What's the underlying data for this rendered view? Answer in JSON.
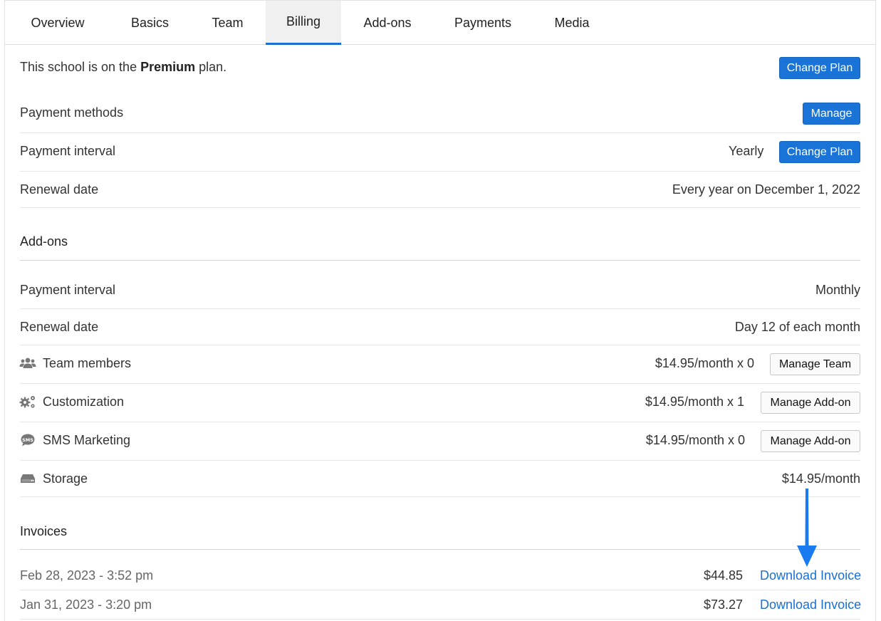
{
  "tabs": [
    {
      "label": "Overview"
    },
    {
      "label": "Basics"
    },
    {
      "label": "Team"
    },
    {
      "label": "Billing"
    },
    {
      "label": "Add-ons"
    },
    {
      "label": "Payments"
    },
    {
      "label": "Media"
    }
  ],
  "plan": {
    "prefix": "This school is on the ",
    "name": "Premium",
    "suffix": " plan.",
    "change_label": "Change Plan"
  },
  "billing": {
    "payment_methods_label": "Payment methods",
    "manage_label": "Manage",
    "interval_label": "Payment interval",
    "interval_value": "Yearly",
    "interval_change_label": "Change Plan",
    "renewal_label": "Renewal date",
    "renewal_value": "Every year on December 1, 2022"
  },
  "addons": {
    "heading": "Add-ons",
    "interval_label": "Payment interval",
    "interval_value": "Monthly",
    "renewal_label": "Renewal date",
    "renewal_value": "Day 12 of each month",
    "items": [
      {
        "label": "Team members",
        "price": "$14.95/month x 0",
        "action": "Manage Team",
        "icon": "users-icon"
      },
      {
        "label": "Customization",
        "price": "$14.95/month x 1",
        "action": "Manage Add-on",
        "icon": "gears-icon"
      },
      {
        "label": "SMS Marketing",
        "price": "$14.95/month x 0",
        "action": "Manage Add-on",
        "icon": "sms-bubble-icon"
      },
      {
        "label": "Storage",
        "price": "$14.95/month",
        "icon": "hard-drive-icon"
      }
    ]
  },
  "invoices": {
    "heading": "Invoices",
    "rows": [
      {
        "date": "Feb 28, 2023 - 3:52 pm",
        "amount": "$44.85",
        "action": "Download Invoice"
      },
      {
        "date": "Jan 31, 2023 - 3:20 pm",
        "amount": "$73.27",
        "action": "Download Invoice"
      }
    ]
  },
  "colors": {
    "accent": "#1a73d6",
    "arrow": "#1a7bf0"
  }
}
